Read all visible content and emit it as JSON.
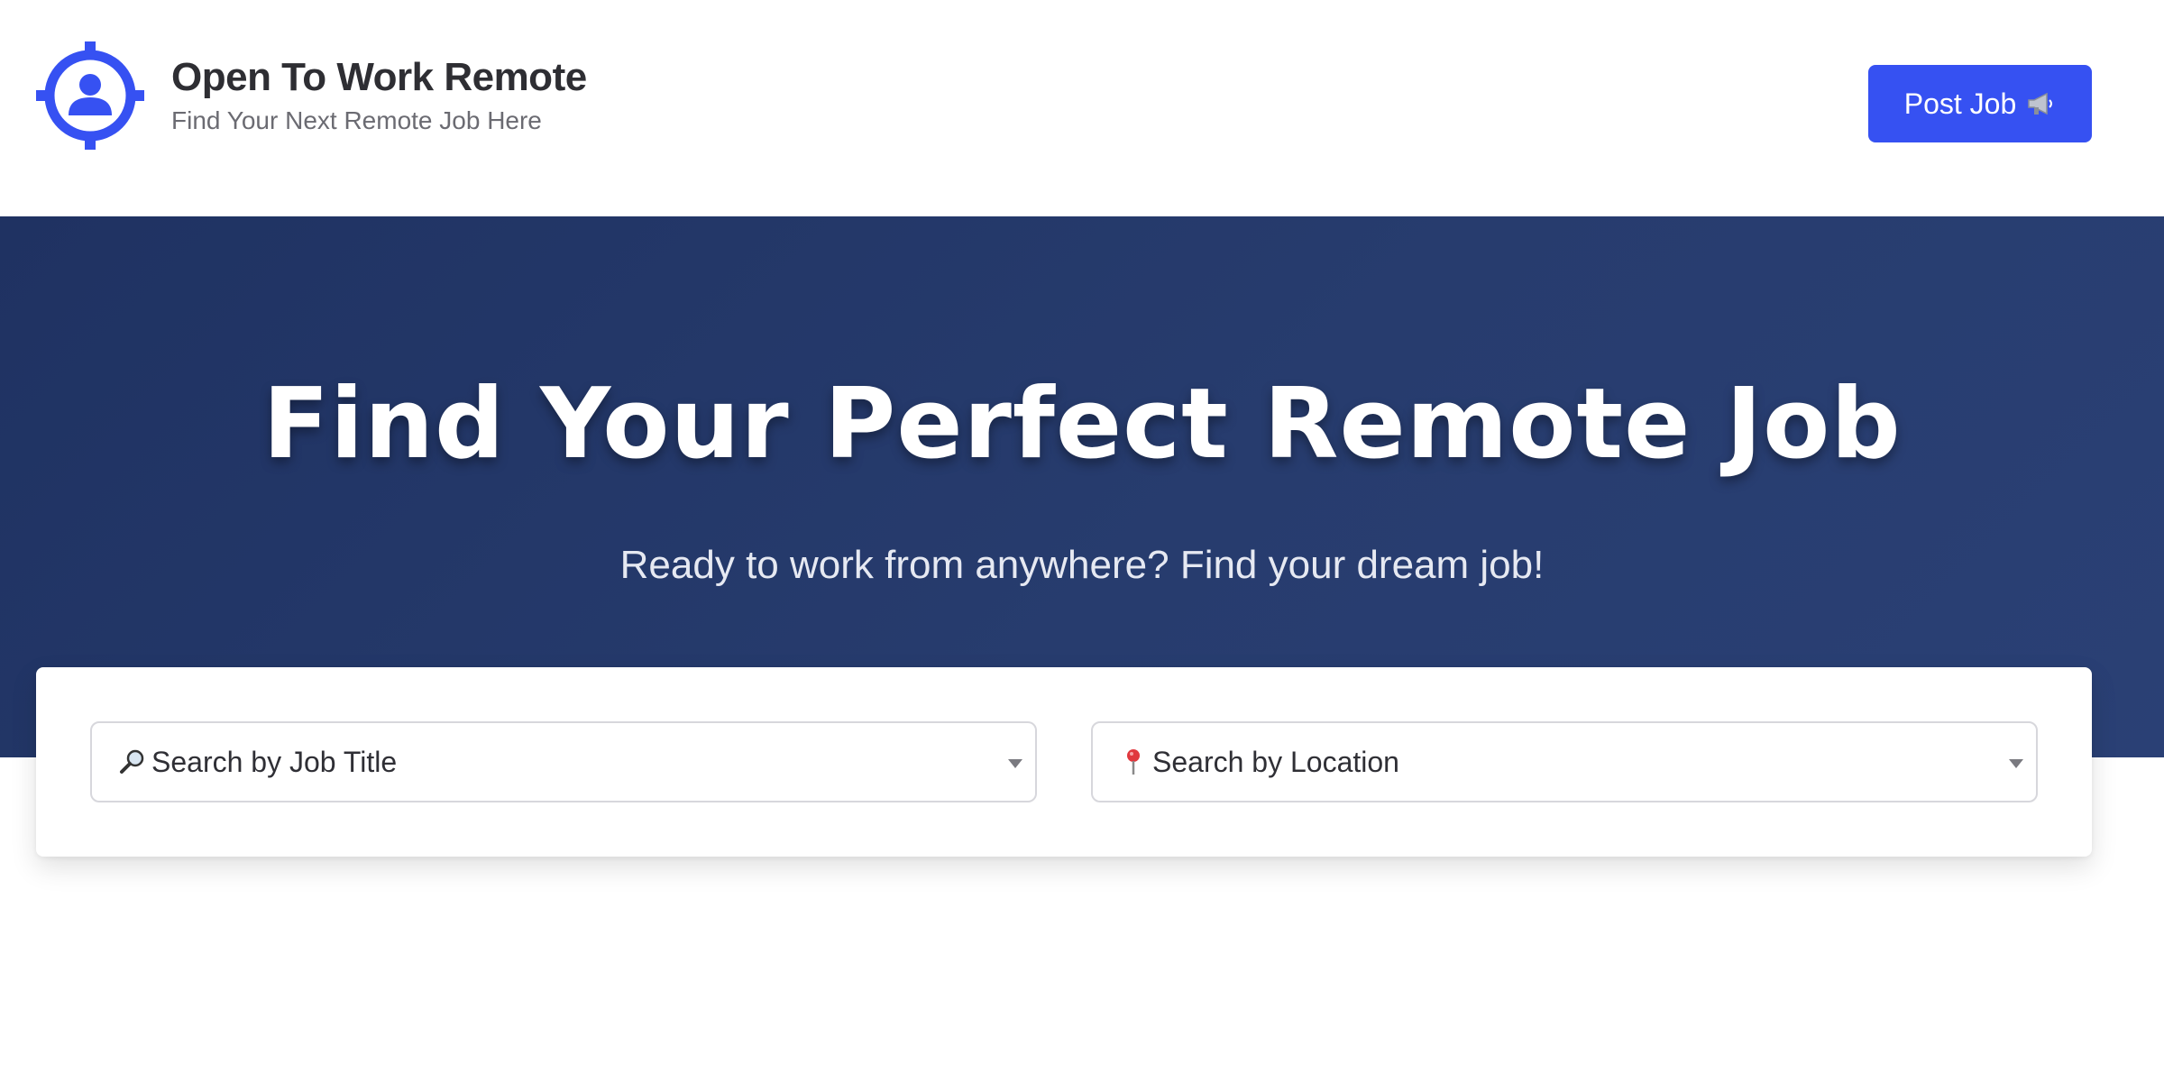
{
  "header": {
    "brand_title": "Open To Work Remote",
    "brand_subtitle": "Find Your Next Remote Job Here",
    "logo_icon": "crosshair-person-icon",
    "post_job_label": "Post Job",
    "post_job_icon": "megaphone-icon"
  },
  "hero": {
    "title": "Find Your Perfect Remote Job",
    "subtitle": "Ready to work from anywhere? Find your dream job!"
  },
  "search": {
    "job_title": {
      "selected": "Search by Job Title",
      "icon": "magnifier-icon"
    },
    "location": {
      "selected": "Search by Location",
      "icon": "pin-icon"
    }
  },
  "colors": {
    "accent": "#3651f2",
    "hero_bg": "#243769",
    "text_dark": "#2e2e33",
    "text_muted": "#6b6b72"
  }
}
